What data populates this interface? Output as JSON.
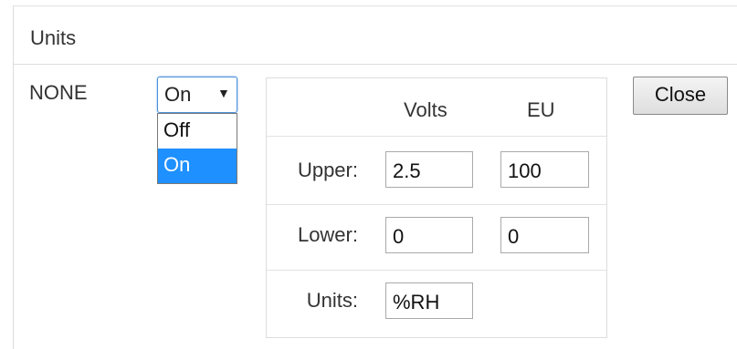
{
  "panel": {
    "title": "Units"
  },
  "row": {
    "label": "NONE"
  },
  "mode_select": {
    "selected": "On",
    "arrow_icon": "triangle-down-icon",
    "options": [
      "Off",
      "On"
    ],
    "highlighted_option": "On"
  },
  "table": {
    "headers": {
      "volts": "Volts",
      "eu": "EU"
    },
    "rows": {
      "upper": {
        "label": "Upper:",
        "volts": "2.5",
        "eu": "100"
      },
      "lower": {
        "label": "Lower:",
        "volts": "0",
        "eu": "0"
      },
      "units": {
        "label": "Units:",
        "value": "%RH"
      }
    }
  },
  "close_button": {
    "label": "Close"
  },
  "colors": {
    "highlight": "#1e90ff",
    "focus_border": "#4a90d9",
    "border": "#dddddd"
  }
}
